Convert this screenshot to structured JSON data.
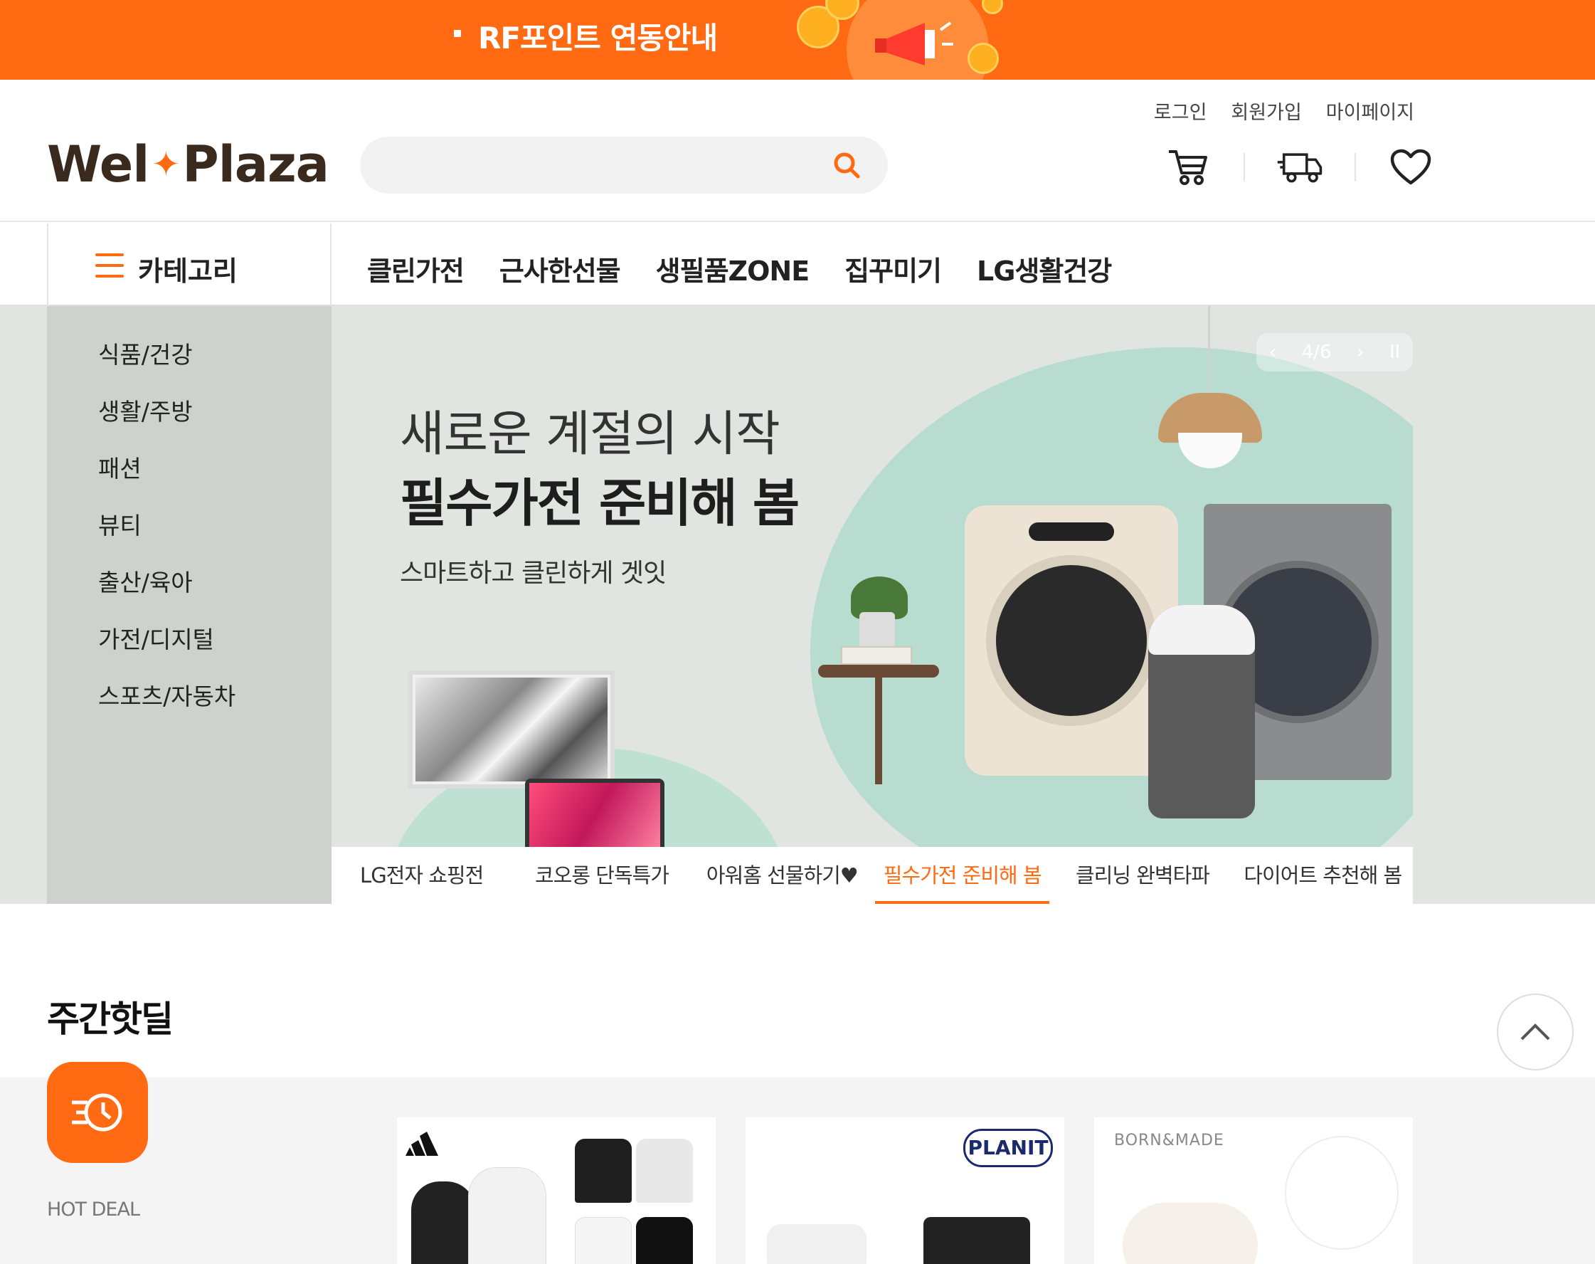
{
  "promo_bar": {
    "text": "RF포인트 연동안내"
  },
  "header": {
    "logo_left": "Wel",
    "logo_right": "Plaza",
    "search": {
      "value": "",
      "placeholder": ""
    },
    "util_links": [
      "로그인",
      "회원가입",
      "마이페이지"
    ],
    "icons": [
      "cart-icon",
      "delivery-truck-icon",
      "heart-icon"
    ]
  },
  "gnb": {
    "category_label": "카테고리",
    "menu": [
      "클린가전",
      "근사한선물",
      "생필품ZONE",
      "집꾸미기",
      "LG생활건강"
    ]
  },
  "side_categories": [
    "식품/건강",
    "생활/주방",
    "패션",
    "뷰티",
    "출산/육아",
    "가전/디지털",
    "스포츠/자동차"
  ],
  "banner": {
    "headline_1": "새로운 계절의 시작",
    "headline_2": "필수가전 준비해 봄",
    "subline": "스마트하고 클린하게 겟잇",
    "pager": {
      "current": "4/6"
    },
    "tabs": [
      {
        "label": "LG전자 쇼핑전",
        "active": false
      },
      {
        "label": "코오롱 단독특가",
        "active": false
      },
      {
        "label": "아워홈 선물하기♥",
        "active": false
      },
      {
        "label": "필수가전 준비해 봄",
        "active": true
      },
      {
        "label": "클리닝 완벽타파",
        "active": false
      },
      {
        "label": "다이어트 추천해 봄",
        "active": false
      }
    ]
  },
  "hot_deal": {
    "section_title": "주간핫딜",
    "label": "HOT DEAL",
    "products": [
      {
        "brand_icon": "adidas-logo-icon"
      },
      {
        "brand_text": "PLANIT products"
      },
      {
        "brand_text": "BORN&MADE"
      }
    ]
  },
  "colors": {
    "accent": "#ff6a13",
    "hero_bg": "#e1e5e2",
    "side_bg": "#cdd2cf",
    "blob": "#b8ddd0"
  }
}
